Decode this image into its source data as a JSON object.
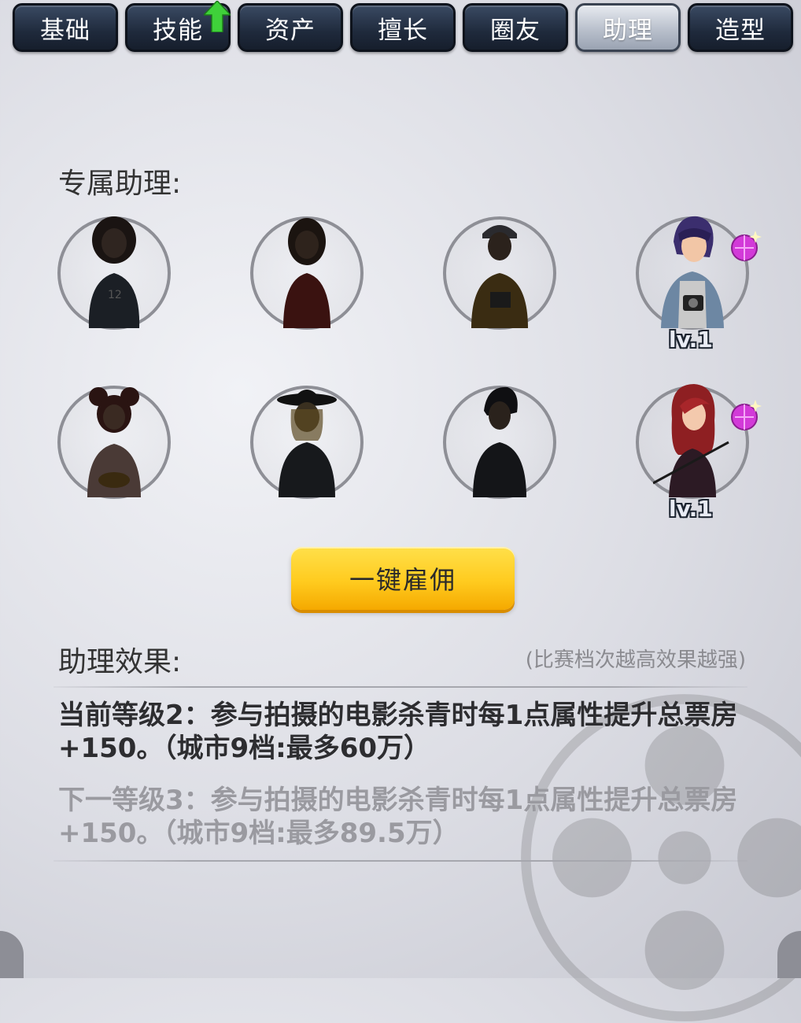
{
  "tabs": [
    {
      "label": "基础",
      "active": false,
      "has_upgrade": false
    },
    {
      "label": "技能",
      "active": false,
      "has_upgrade": true
    },
    {
      "label": "资产",
      "active": false,
      "has_upgrade": false
    },
    {
      "label": "擅长",
      "active": false,
      "has_upgrade": false
    },
    {
      "label": "圈友",
      "active": false,
      "has_upgrade": false
    },
    {
      "label": "助理",
      "active": true,
      "has_upgrade": false
    },
    {
      "label": "造型",
      "active": false,
      "has_upgrade": false
    }
  ],
  "assistants_heading": "专属助理:",
  "assistants": [
    {
      "owned": false,
      "level": "",
      "has_gem": false
    },
    {
      "owned": false,
      "level": "",
      "has_gem": false
    },
    {
      "owned": false,
      "level": "",
      "has_gem": false
    },
    {
      "owned": true,
      "level": "lv.1",
      "has_gem": true
    },
    {
      "owned": false,
      "level": "",
      "has_gem": false
    },
    {
      "owned": false,
      "level": "",
      "has_gem": false
    },
    {
      "owned": false,
      "level": "",
      "has_gem": false
    },
    {
      "owned": true,
      "level": "lv.1",
      "has_gem": true
    }
  ],
  "hire_button": "一键雇佣",
  "effect_heading": "助理效果:",
  "effect_hint": "(比赛档次越高效果越强)",
  "current_effect": "当前等级2：参与拍摄的电影杀青时每1点属性提升总票房+150。（城市9档:最多60万）",
  "next_effect": "下一等级3：参与拍摄的电影杀青时每1点属性提升总票房+150。（城市9档:最多89.5万）",
  "colors": {
    "tab_dark": "#1f2a3c",
    "tab_active": "#b9c0cc",
    "button_yellow": "#ffcb1f",
    "upgrade_green": "#3fd13a",
    "gem_pink": "#d23ad8"
  }
}
